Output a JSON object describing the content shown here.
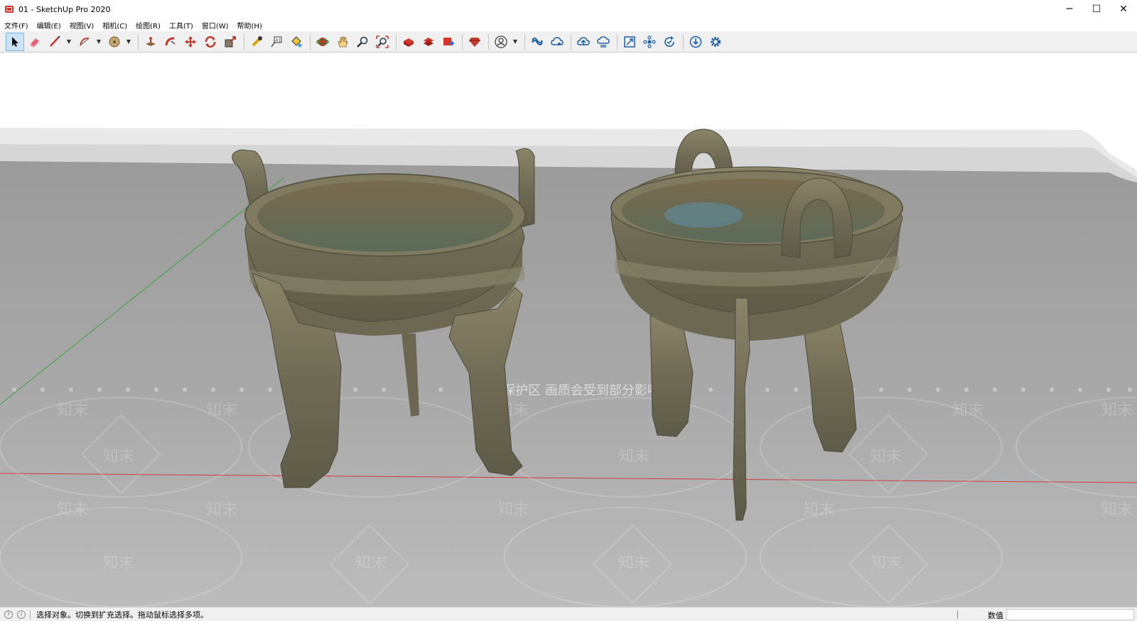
{
  "window": {
    "title": "01 - SketchUp Pro 2020",
    "minimize_glyph": "─",
    "maximize_glyph": "☐",
    "close_glyph": "✕"
  },
  "menu": {
    "items": [
      "文件(F)",
      "编辑(E)",
      "视图(V)",
      "相机(C)",
      "绘图(R)",
      "工具(T)",
      "窗口(W)",
      "帮助(H)"
    ]
  },
  "toolbar": {
    "icons": [
      "select-icon",
      "eraser-icon",
      "line-icon",
      "arc-icon",
      "shape-icon",
      "push-pull-icon",
      "follow-me-icon",
      "move-icon",
      "rotate-icon",
      "scale-icon",
      "tape-measure-icon",
      "text-icon",
      "paint-bucket-icon",
      "orbit-icon",
      "pan-icon",
      "zoom-icon",
      "zoom-extents-icon",
      "warehouse-icon",
      "extension-warehouse-icon",
      "layout-send-icon",
      "ruby-icon",
      "account-icon",
      "trimble-connect-icon",
      "connect-share-icon",
      "cloud-upload-icon",
      "cloud-sync-icon",
      "scenes-icon",
      "components-icon",
      "refresh-icon",
      "download-icon",
      "settings-icon"
    ],
    "accent_color": "#7eb4ea"
  },
  "viewport": {
    "watermark_banner": "水印保护区   画质会受到部分影响",
    "watermark_word": "知末",
    "sky_color": "#ffffff",
    "ground_color": "#a9a9a9",
    "red_axis_color": "#d23b3b",
    "green_axis_color": "#3aa53a"
  },
  "status": {
    "hint": "选择对象。切换到扩充选择。拖动鼠标选择多项。",
    "measurements_label": "数值",
    "measurements_value": ""
  }
}
